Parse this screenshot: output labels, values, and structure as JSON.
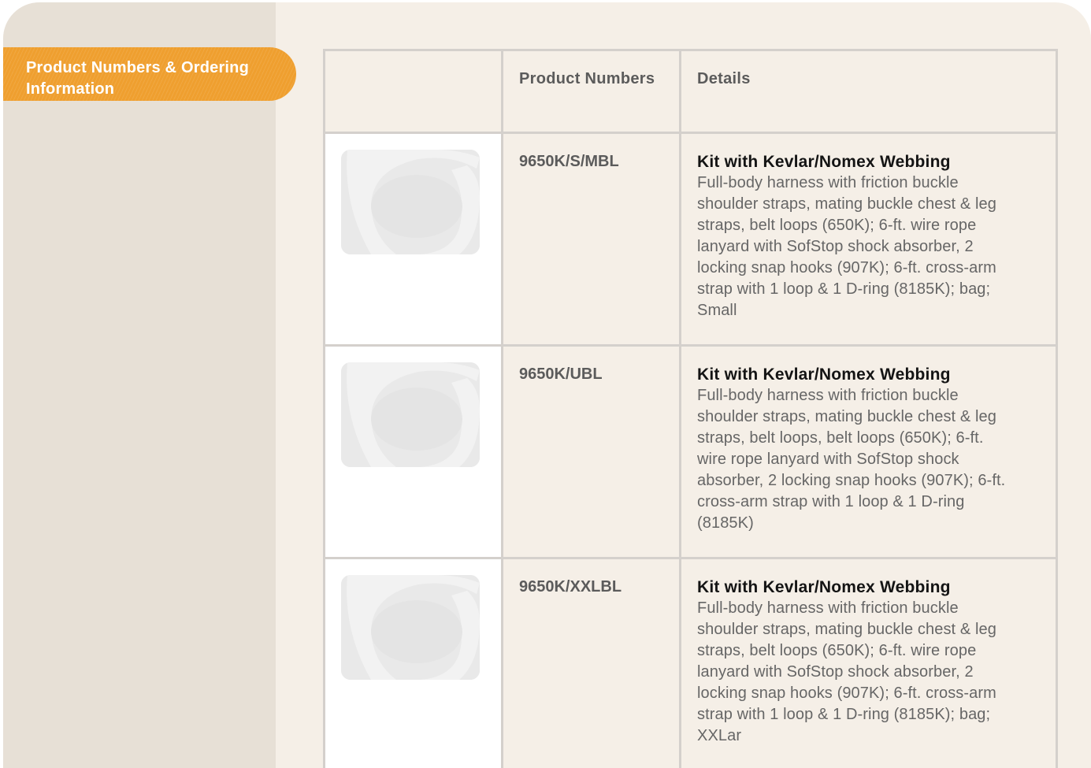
{
  "sidebar": {
    "tab_label": "Product Numbers & Ordering Information"
  },
  "table": {
    "headers": [
      "",
      "Product Numbers",
      "Details"
    ],
    "rows": [
      {
        "image_icon": "product-image-placeholder-icon",
        "product_number": "9650K/S/MBL",
        "title": "Kit with Kevlar/Nomex Webbing",
        "description": "Full-body harness with friction buckle shoulder straps, mating buckle chest & leg straps, belt loops (650K); 6-ft. wire rope lanyard with SofStop shock absorber, 2 locking snap hooks (907K); 6-ft. cross-arm strap with 1 loop & 1 D-ring (8185K); bag; Small"
      },
      {
        "image_icon": "product-image-placeholder-icon",
        "product_number": "9650K/UBL",
        "title": "Kit with Kevlar/Nomex Webbing",
        "description": "Full-body harness with friction buckle shoulder straps, mating buckle chest & leg straps, belt loops, belt loops (650K); 6-ft. wire rope lanyard with SofStop shock absorber, 2 locking snap hooks (907K); 6-ft. cross-arm strap with 1 loop & 1 D-ring (8185K)"
      },
      {
        "image_icon": "product-image-placeholder-icon",
        "product_number": "9650K/XXLBL",
        "title": "Kit with Kevlar/Nomex Webbing",
        "description": "Full-body harness with friction buckle shoulder straps, mating buckle chest & leg straps, belt loops (650K); 6-ft. wire rope lanyard with SofStop shock absorber, 2 locking snap hooks (907K); 6-ft. cross-arm strap with 1 loop & 1 D-ring (8185K); bag; XXLar"
      }
    ]
  },
  "colors": {
    "background": "#f5efe7",
    "sidebar": "#e7e0d6",
    "tab_accent": "#ef9f2f",
    "table_border": "#d4d0cc",
    "header_text": "#5b5b5b",
    "title_text": "#141414",
    "body_text": "#666666"
  }
}
